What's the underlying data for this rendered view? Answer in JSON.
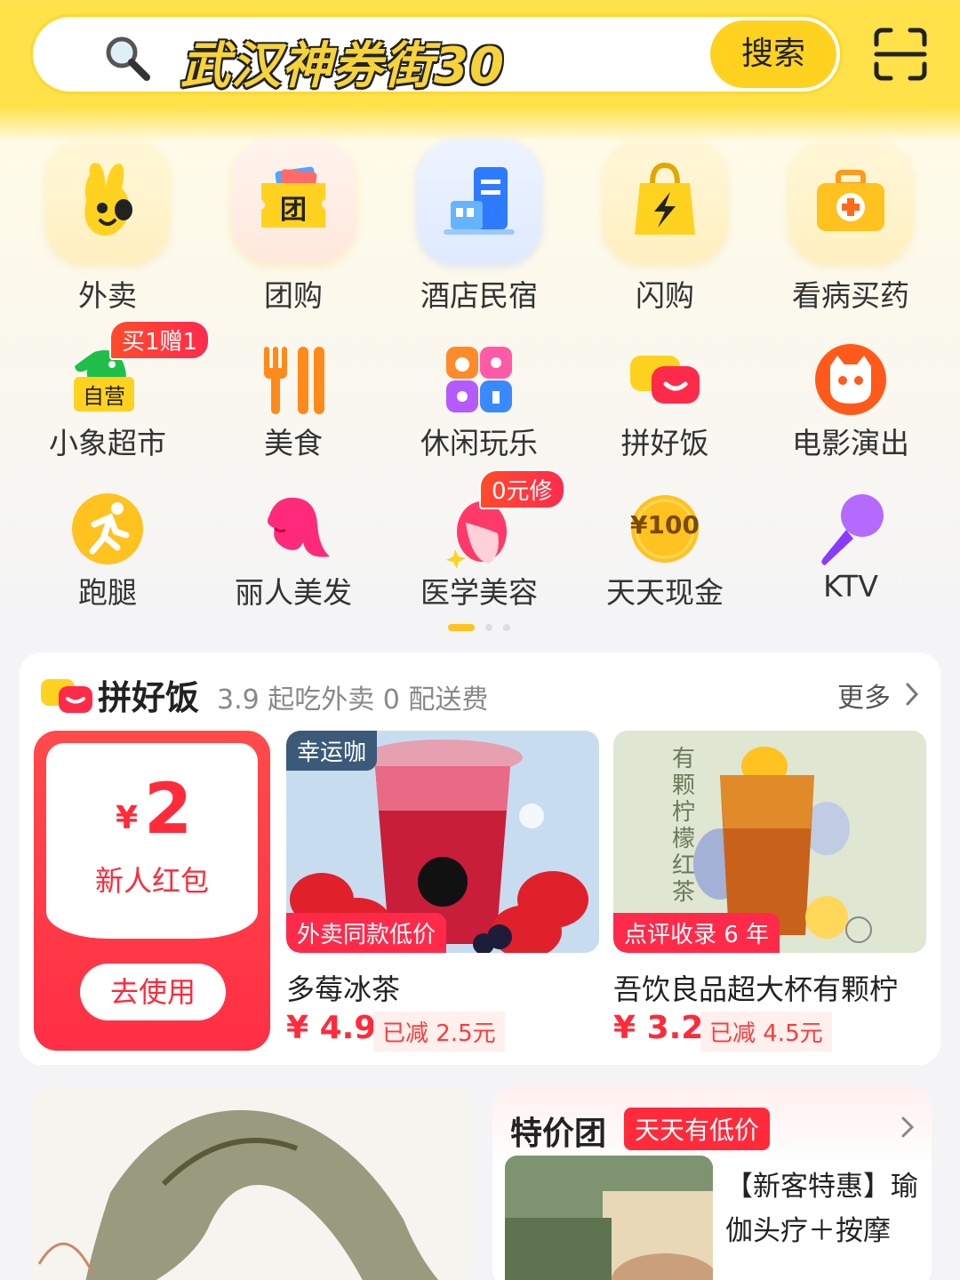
{
  "search": {
    "query": "武汉神券街30",
    "button_label": "搜索"
  },
  "categories_row1": [
    {
      "label": "外卖",
      "icon": "waimai-rabbit-icon"
    },
    {
      "label": "团购",
      "icon": "tuangou-ticket-icon"
    },
    {
      "label": "酒店民宿",
      "icon": "hotel-building-icon"
    },
    {
      "label": "闪购",
      "icon": "flash-bag-icon"
    },
    {
      "label": "看病买药",
      "icon": "medicine-kit-icon"
    }
  ],
  "categories_row2": [
    {
      "label": "小象超市",
      "icon": "elephant-market-icon",
      "badge": "买1赠1",
      "sub_badge": "自营"
    },
    {
      "label": "美食",
      "icon": "fork-knife-icon"
    },
    {
      "label": "休闲玩乐",
      "icon": "leisure-grid-icon"
    },
    {
      "label": "拼好饭",
      "icon": "pinhaofan-bowl-icon"
    },
    {
      "label": "电影演出",
      "icon": "cat-movie-icon"
    }
  ],
  "categories_row3": [
    {
      "label": "跑腿",
      "icon": "runner-icon"
    },
    {
      "label": "丽人美发",
      "icon": "hair-beauty-icon"
    },
    {
      "label": "医学美容",
      "icon": "medical-beauty-icon",
      "badge": "0元修"
    },
    {
      "label": "天天现金",
      "icon": "cash-coin-icon",
      "coin_text": "¥100"
    },
    {
      "label": "KTV",
      "icon": "microphone-icon"
    }
  ],
  "pinhaofan": {
    "title": "拼好饭",
    "subtitle": "3.9 起吃外卖 0 配送费",
    "more_label": "更多",
    "coupon": {
      "currency": "¥",
      "amount": "2",
      "name": "新人红包",
      "button_label": "去使用"
    },
    "products": [
      {
        "brand_tag": "幸运咖",
        "bottom_tag": "外卖同款低价",
        "name": "多莓冰茶",
        "price": "¥ 4.9",
        "discount": "已减 2.5元"
      },
      {
        "brand_tag": "",
        "bottom_tag": "点评收录 6 年",
        "name": "吾饮良品超大杯有颗柠",
        "price": "¥ 3.2",
        "discount": "已减 4.5元"
      }
    ]
  },
  "deal": {
    "title": "特价团",
    "badge": "天天有低价",
    "text": "【新客特惠】瑜伽头疗＋按摩"
  },
  "colors": {
    "brand_yellow": "#ffd21f",
    "accent_red": "#ff2a3a"
  }
}
